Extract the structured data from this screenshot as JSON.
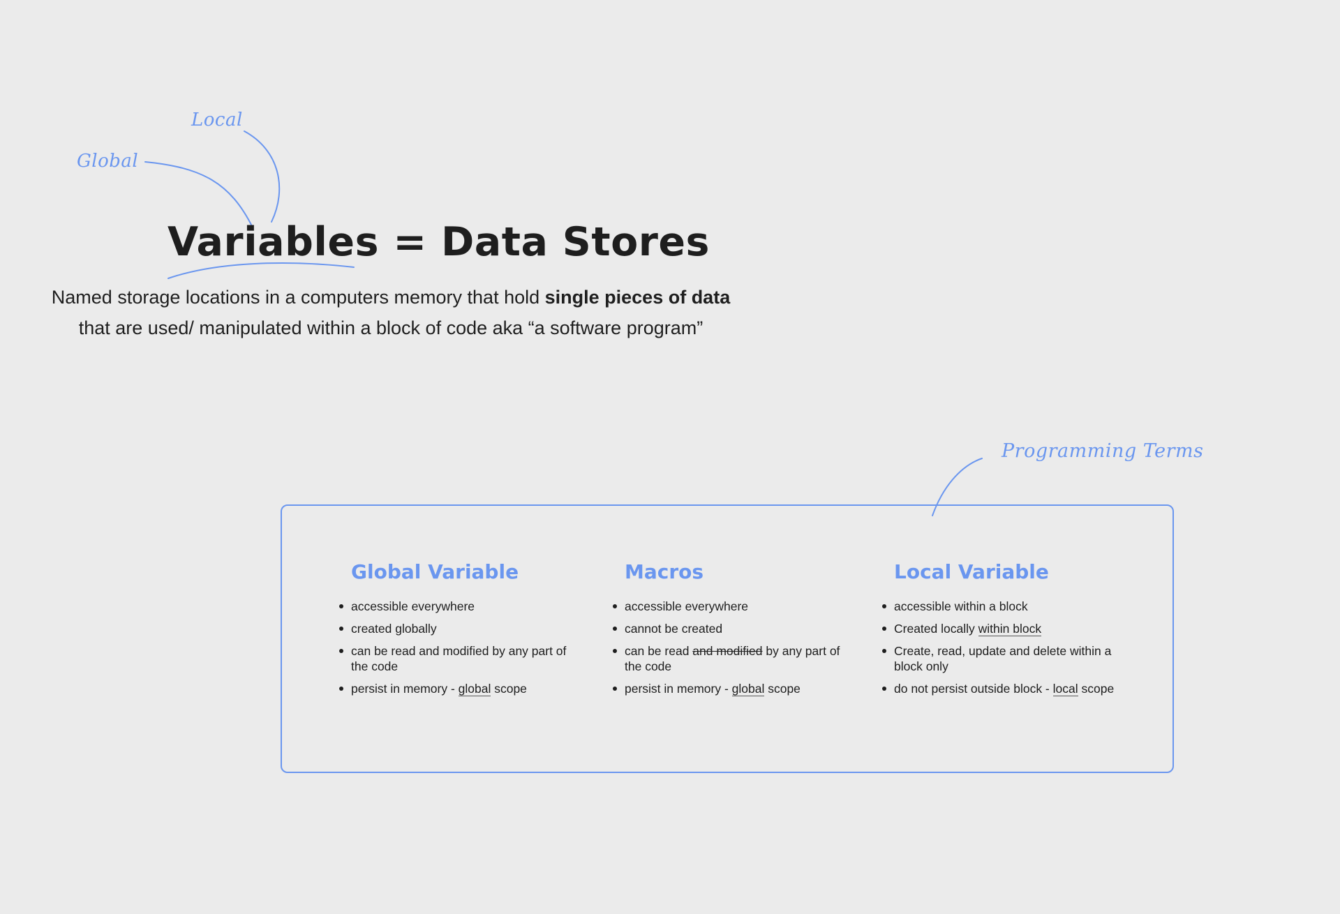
{
  "annotations": {
    "global": "Global",
    "local": "Local",
    "terms": "Programming Terms"
  },
  "title": "Variables = Data Stores",
  "subtitle": {
    "line1_plain": "Named storage locations in a computers memory that hold ",
    "line1_bold": "single pieces of data",
    "line2": "that are used/ manipulated within a block of code aka “a software program”"
  },
  "terms": [
    {
      "title": "Global Variable",
      "items": [
        {
          "text": "accessible everywhere"
        },
        {
          "text": "created globally"
        },
        {
          "text": "can be read and modified by any part of the code"
        },
        {
          "pre": "persist in memory - ",
          "underline": "global",
          "post": " scope"
        }
      ]
    },
    {
      "title": "Macros",
      "items": [
        {
          "text": "accessible everywhere"
        },
        {
          "text": "cannot be created"
        },
        {
          "pre": "can be read ",
          "strike": "and modified",
          "post": " by any part of the code"
        },
        {
          "pre": "persist in memory - ",
          "underline": "global",
          "post": " scope"
        }
      ]
    },
    {
      "title": "Local Variable",
      "items": [
        {
          "text": "accessible within a block"
        },
        {
          "pre": "Created locally ",
          "underline": "within block",
          "post": ""
        },
        {
          "text": "Create, read, update and delete within a block only"
        },
        {
          "pre": "do not persist outside block - ",
          "underline": "local",
          "post": " scope"
        }
      ]
    }
  ],
  "colors": {
    "accent": "#6a96ef",
    "background": "#ebebeb",
    "text": "#1e1e1e"
  }
}
